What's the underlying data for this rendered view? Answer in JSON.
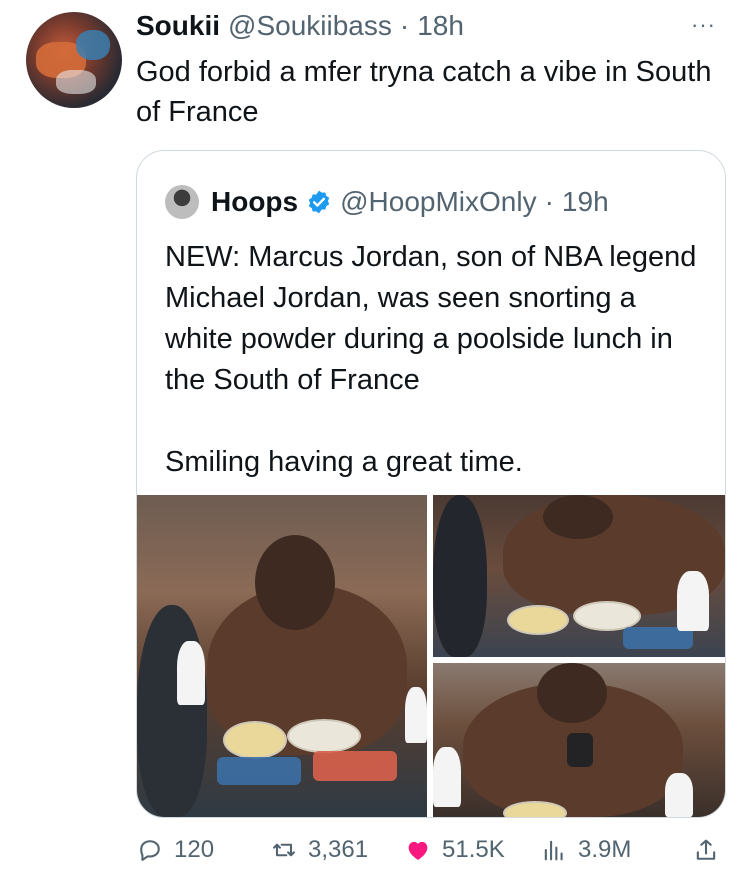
{
  "tweet": {
    "display_name": "Soukii",
    "handle": "@Soukiibass",
    "separator": "·",
    "time": "18h",
    "more_label": "···",
    "text": "God forbid a mfer tryna catch a vibe in South of France"
  },
  "quote": {
    "display_name": "Hoops",
    "handle": "@HoopMixOnly",
    "separator": "·",
    "time": "19h",
    "text": "NEW: Marcus Jordan, son of NBA legend Michael Jordan, was seen snorting a white powder during a poolside lunch in the South of France\n\nSmiling having a great time.",
    "verified_color": "#1d9bf0"
  },
  "actions": {
    "replies": "120",
    "reposts": "3,361",
    "likes": "51.5K",
    "views": "3.9M"
  },
  "colors": {
    "text": "#0f1419",
    "secondary": "#536471",
    "like": "#f91880",
    "border": "#cfd9de"
  }
}
